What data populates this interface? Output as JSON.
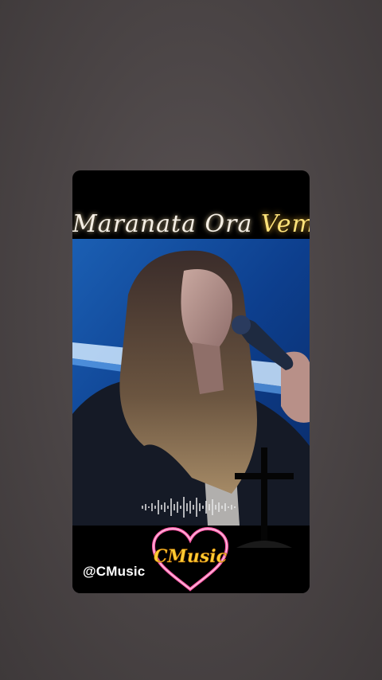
{
  "story": {
    "title_part1": "Maranata Ora",
    "title_part2": "Vem",
    "handle": "@CMusic",
    "logo_text": "CMusic",
    "image_description_icon": "singer-photo"
  }
}
